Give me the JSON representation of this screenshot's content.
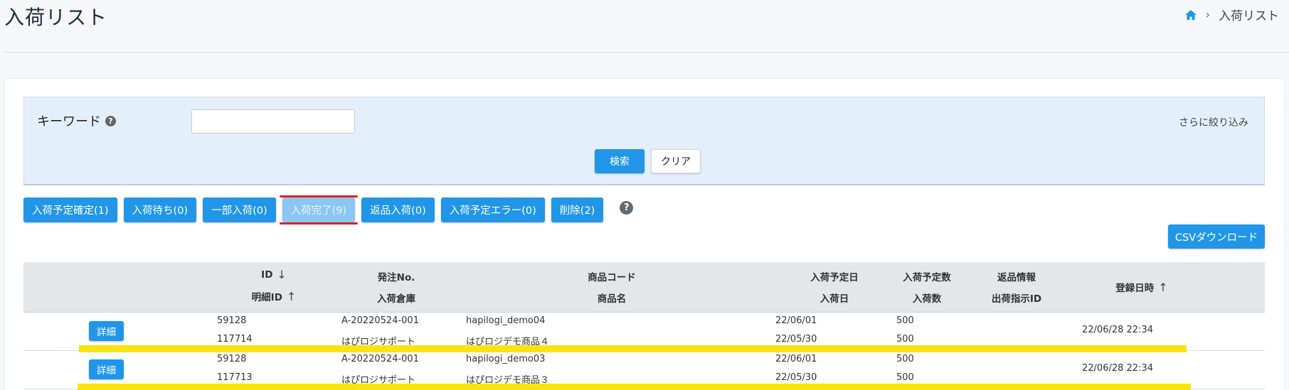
{
  "header": {
    "title": "入荷リスト",
    "breadcrumb_current": "入荷リスト",
    "breadcrumb_sep": "›"
  },
  "search": {
    "keyword_label": "キーワード",
    "keyword_value": "",
    "help_glyph": "?",
    "refine_label": "さらに絞り込み",
    "search_button": "検索",
    "clear_button": "クリア"
  },
  "filters": [
    {
      "label": "入荷予定確定(1)",
      "active": false
    },
    {
      "label": "入荷待ち(0)",
      "active": false
    },
    {
      "label": "一部入荷(0)",
      "active": false
    },
    {
      "label": "入荷完了(9)",
      "active": true
    },
    {
      "label": "返品入荷(0)",
      "active": false
    },
    {
      "label": "入荷予定エラー(0)",
      "active": false
    },
    {
      "label": "削除(2)",
      "active": false
    }
  ],
  "csv_button": "CSVダウンロード",
  "table": {
    "headers": {
      "id": "ID",
      "detail_id": "明細ID",
      "order_no": "発注No.",
      "warehouse": "入荷倉庫",
      "product_code": "商品コード",
      "product_name": "商品名",
      "planned_date": "入荷予定日",
      "arrival_date": "入荷日",
      "planned_qty": "入荷予定数",
      "arrival_qty": "入荷数",
      "return_info": "返品情報",
      "shipping_id": "出荷指示ID",
      "registered_at": "登録日時"
    },
    "sort_arrows": {
      "id": "↓",
      "detail_id": "↑",
      "registered_at": "↑"
    },
    "detail_button": "詳細",
    "rows": [
      {
        "id": "59128",
        "detail_id": "117714",
        "order_no": "A-20220524-001",
        "warehouse": "はぴロジサポート",
        "product_code": "hapilogi_demo04",
        "product_name": "はぴロジデモ商品４",
        "planned_date": "22/06/01",
        "arrival_date": "22/05/30",
        "planned_qty": "500",
        "arrival_qty": "500",
        "registered_at": "22/06/28 22:34"
      },
      {
        "id": "59128",
        "detail_id": "117713",
        "order_no": "A-20220524-001",
        "warehouse": "はぴロジサポート",
        "product_code": "hapilogi_demo03",
        "product_name": "はぴロジデモ商品３",
        "planned_date": "22/06/01",
        "arrival_date": "22/05/30",
        "planned_qty": "500",
        "arrival_qty": "500",
        "registered_at": "22/06/28 22:34"
      }
    ]
  },
  "colors": {
    "primary": "#2196e8",
    "active_filter": "#8cc6f3",
    "annotation_red": "#e02020",
    "annotation_yellow": "#f9e50d"
  }
}
